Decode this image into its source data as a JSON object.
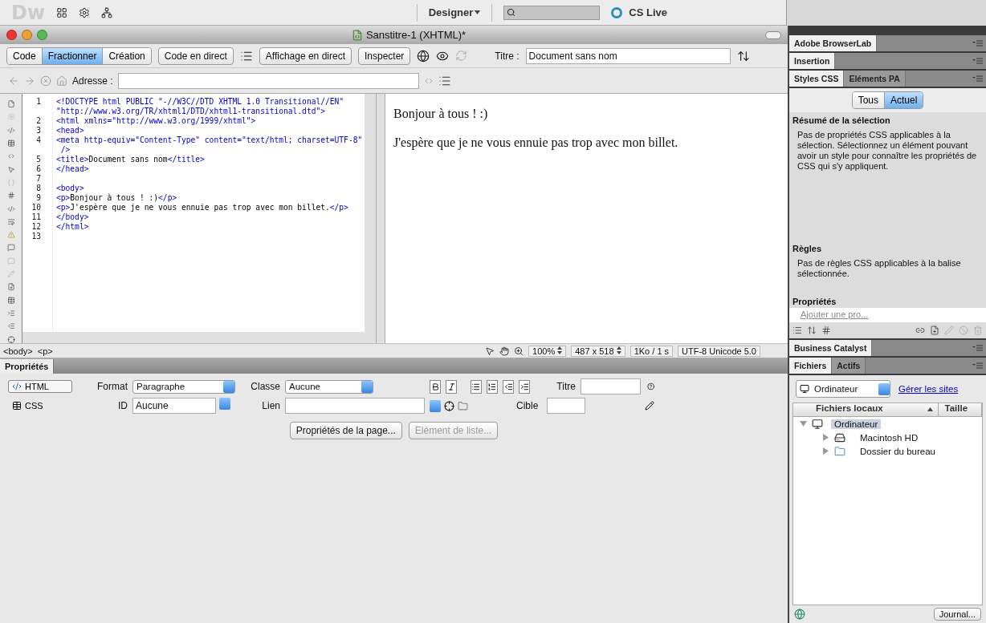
{
  "app_bar": {
    "logo": "Dw",
    "workspace": "Designer",
    "cs_live": "CS Live"
  },
  "document": {
    "title": "Sanstitre-1 (XHTML)*",
    "view_buttons": [
      {
        "label": "Code",
        "selected": false
      },
      {
        "label": "Fractionner",
        "selected": true
      },
      {
        "label": "Création",
        "selected": false
      }
    ],
    "live_buttons": [
      "Code en direct",
      "Affichage en direct",
      "Inspecter"
    ],
    "title_label": "Titre :",
    "title_value": "Document sans nom",
    "address_label": "Adresse :"
  },
  "code": [
    {
      "number": "1",
      "segments": [
        {
          "kind": "tag",
          "text": "<!DOCTYPE html PUBLIC \"-//W3C//DTD XHTML 1.0 Transitional//EN\""
        }
      ],
      "wrap": [
        {
          "kind": "tag",
          "text": "\"http://www.w3.org/TR/xhtml1/DTD/xhtml1-transitional.dtd\">"
        }
      ]
    },
    {
      "number": "2",
      "segments": [
        {
          "kind": "tag",
          "text": "<html xmlns=\"http://www.w3.org/1999/xhtml\">"
        }
      ]
    },
    {
      "number": "3",
      "segments": [
        {
          "kind": "tag",
          "text": "<head>"
        }
      ]
    },
    {
      "number": "4",
      "segments": [
        {
          "kind": "tag",
          "text": "<meta http-equiv=\"Content-Type\" content=\"text/html; charset=UTF-8\""
        }
      ],
      "wrap": [
        {
          "kind": "tag",
          "text": " />"
        }
      ]
    },
    {
      "number": "5",
      "segments": [
        {
          "kind": "tag",
          "text": "<title>"
        },
        {
          "kind": "text",
          "text": "Document sans nom"
        },
        {
          "kind": "tag",
          "text": "</title>"
        }
      ]
    },
    {
      "number": "6",
      "segments": [
        {
          "kind": "tag",
          "text": "</head>"
        }
      ]
    },
    {
      "number": "7"
    },
    {
      "number": "8",
      "segments": [
        {
          "kind": "tag",
          "text": "<body>"
        }
      ]
    },
    {
      "number": "9",
      "segments": [
        {
          "kind": "tag",
          "text": "<p>"
        },
        {
          "kind": "text",
          "text": "Bonjour à tous ! :)"
        },
        {
          "kind": "tag",
          "text": "</p>"
        }
      ]
    },
    {
      "number": "10",
      "segments": [
        {
          "kind": "tag",
          "text": "<p>"
        },
        {
          "kind": "text",
          "text": "J'espère que je ne vous ennuie pas trop avec mon billet."
        },
        {
          "kind": "tag",
          "text": "</p>"
        }
      ]
    },
    {
      "number": "11",
      "segments": [
        {
          "kind": "tag",
          "text": "</body>"
        }
      ]
    },
    {
      "number": "12",
      "segments": [
        {
          "kind": "tag",
          "text": "</html>"
        }
      ]
    },
    {
      "number": "13"
    }
  ],
  "preview": [
    "Bonjour à tous ! :)",
    "J'espère que je ne vous ennuie pas trop avec mon billet."
  ],
  "status_bar": {
    "tags": [
      "<body>",
      "<p>"
    ],
    "zoom": "100%",
    "size": "487 x 518",
    "download": "1Ko / 1 s",
    "encoding": "UTF-8 Unicode 5.0"
  },
  "properties": {
    "title": "Propriétés",
    "modes": [
      {
        "label": "HTML",
        "selected": true
      },
      {
        "label": "CSS",
        "selected": false
      }
    ],
    "format_label": "Format",
    "format_value": "Paragraphe",
    "id_label": "ID",
    "id_value": "Aucune",
    "class_label": "Classe",
    "class_value": "Aucune",
    "link_label": "Lien",
    "title_label": "Titre",
    "target_label": "Cible",
    "page_button": "Propriétés de la page...",
    "list_button": {
      "label": "Elément de liste...",
      "disabled": true
    }
  },
  "panels": {
    "browserlab": "Adobe BrowserLab",
    "insertion": "Insertion",
    "css_tabs": [
      {
        "label": "Styles CSS",
        "selected": true
      },
      {
        "label": "Eléments PA",
        "selected": false
      }
    ],
    "css_modes": [
      {
        "label": "Tous",
        "selected": false
      },
      {
        "label": "Actuel",
        "selected": true
      }
    ],
    "summary_title": "Résumé de la sélection",
    "summary_text": "Pas de propriétés CSS applicables à la sélection.  Sélectionnez un élément pouvant avoir un style pour connaître les propriétés de CSS qui s'y appliquent.",
    "rules_title": "Règles",
    "rules_text": "Pas de règles CSS applicables à la balise sélectionnée.",
    "props_title": "Propriétés",
    "add_property": "Ajouter une pro...",
    "business": "Business Catalyst",
    "file_tabs": [
      {
        "label": "Fichiers",
        "selected": true
      },
      {
        "label": "Actifs",
        "selected": false
      }
    ],
    "site": "Ordinateur",
    "manage": "Gérer les sites",
    "columns": [
      "Fichiers locaux",
      "Taille"
    ],
    "tree": [
      {
        "label": "Ordinateur",
        "kind": "computer",
        "expanded": true,
        "selected": true,
        "children": [
          {
            "label": "Macintosh HD",
            "kind": "disk",
            "expanded": false,
            "selected": false
          },
          {
            "label": "Dossier du bureau",
            "kind": "folder",
            "expanded": false,
            "selected": false
          }
        ]
      }
    ],
    "journal": "Journal..."
  }
}
